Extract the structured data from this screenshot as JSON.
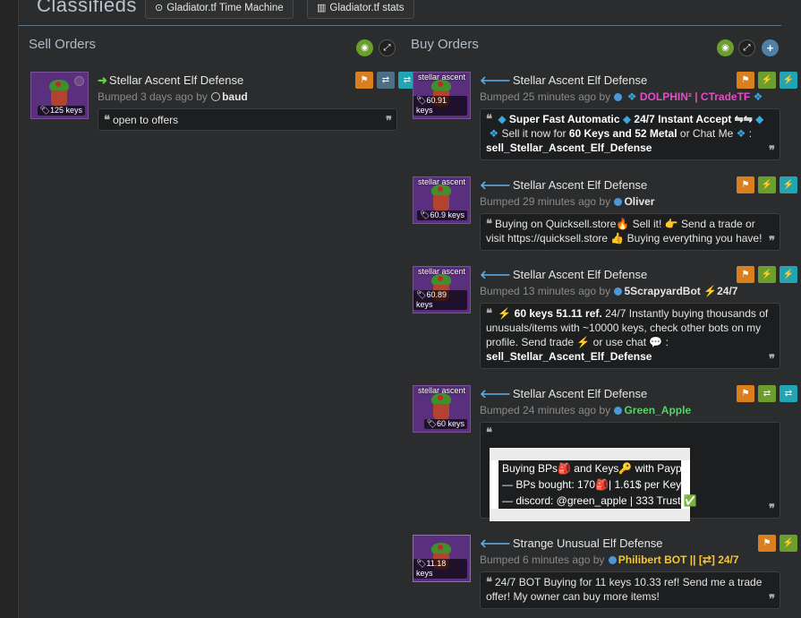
{
  "header": {
    "title": "Classifieds",
    "buttons": [
      {
        "label": "Gladiator.tf Time Machine",
        "icon": "clock-icon"
      },
      {
        "label": "Gladiator.tf stats",
        "icon": "bar-chart-icon"
      }
    ]
  },
  "sell": {
    "heading": "Sell Orders",
    "listings": [
      {
        "title": "Stellar Ascent Elf Defense",
        "price": "125 keys",
        "bumped": "Bumped 3 days ago by",
        "user": "baud",
        "comment": "open to offers"
      }
    ]
  },
  "buy": {
    "heading": "Buy Orders",
    "listings": [
      {
        "thumb_label": "stellar ascent",
        "price": "60.91 keys",
        "title": "Stellar Ascent Elf Defense",
        "bumped": "Bumped 25 minutes ago by",
        "user": "DOLPHIN² | CTradeTF",
        "comment_bold1": "Super Fast Automatic",
        "comment_bold2": "24/7 Instant Accept ⇋⇋",
        "comment_line2a": "Sell it now for",
        "comment_line2b": "60 Keys and 52 Metal",
        "comment_line2c": "or Chat Me",
        "comment_line3": "sell_Stellar_Ascent_Elf_Defense"
      },
      {
        "thumb_label": "stellar ascent",
        "price": "60.9 keys",
        "title": "Stellar Ascent Elf Defense",
        "bumped": "Bumped 29 minutes ago by",
        "user": "Oliver",
        "comment_line1": "Buying on Quicksell.store🔥 Sell it! 👉 Send a trade or",
        "comment_line2": "visit https://quicksell.store 👍 Buying everything you have!"
      },
      {
        "thumb_label": "stellar ascent",
        "price": "60.89 keys",
        "title": "Stellar Ascent Elf Defense",
        "bumped": "Bumped 13 minutes ago by",
        "user": "5ScrapyardBot",
        "user_suffix": "24/7",
        "comment_bold": "60 keys 51.11 ref.",
        "comment_rest1": "24/7 Instantly buying thousands of",
        "comment_line2": "unusuals/items with ~10000 keys, check other bots on my",
        "comment_line3": "profile. Send   trade ⚡ or   use   chat 💬 :",
        "comment_line4": "sell_Stellar_Ascent_Elf_Defense"
      },
      {
        "thumb_label": "stellar ascent",
        "price": "60 keys",
        "title": "Stellar Ascent Elf Defense",
        "bumped": "Bumped 24 minutes ago by",
        "user": "Green_Apple",
        "note_lines": [
          "Buying BPs🎒 and Keys🔑 with Paypal",
          "— BPs bought: 170🎒| 1.61$ per Key",
          "— discord: @green_apple | 333 Trust ✅"
        ]
      },
      {
        "price": "11.18 keys",
        "title": "Strange Unusual Elf Defense",
        "bumped": "Bumped 6 minutes ago by",
        "user": "Philibert BOT || [⇄] 24/7",
        "comment_line1": "24/7 BOT Buying for 11 keys 10.33 ref! Send me a trade",
        "comment_line2": "offer! My owner can buy more items!"
      }
    ]
  }
}
